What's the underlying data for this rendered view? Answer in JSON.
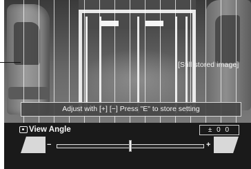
{
  "camera": {
    "still_label": "[Still stored image]"
  },
  "message": {
    "text": "Adjust with [+] [−]    Press \"E\" to store setting"
  },
  "view_angle": {
    "title": "View Angle",
    "value_text": "± 0 0",
    "minus_label": "−",
    "plus_label": "+",
    "slider_position": 0.5
  },
  "icons": {
    "title_icon": "camera-icon",
    "decrease": "trapezoid-left-icon",
    "increase": "trapezoid-right-icon"
  },
  "colors": {
    "panel_background": "#1a1a1a",
    "text": "#f5f5f5",
    "grid_lines": "#ffffff"
  }
}
